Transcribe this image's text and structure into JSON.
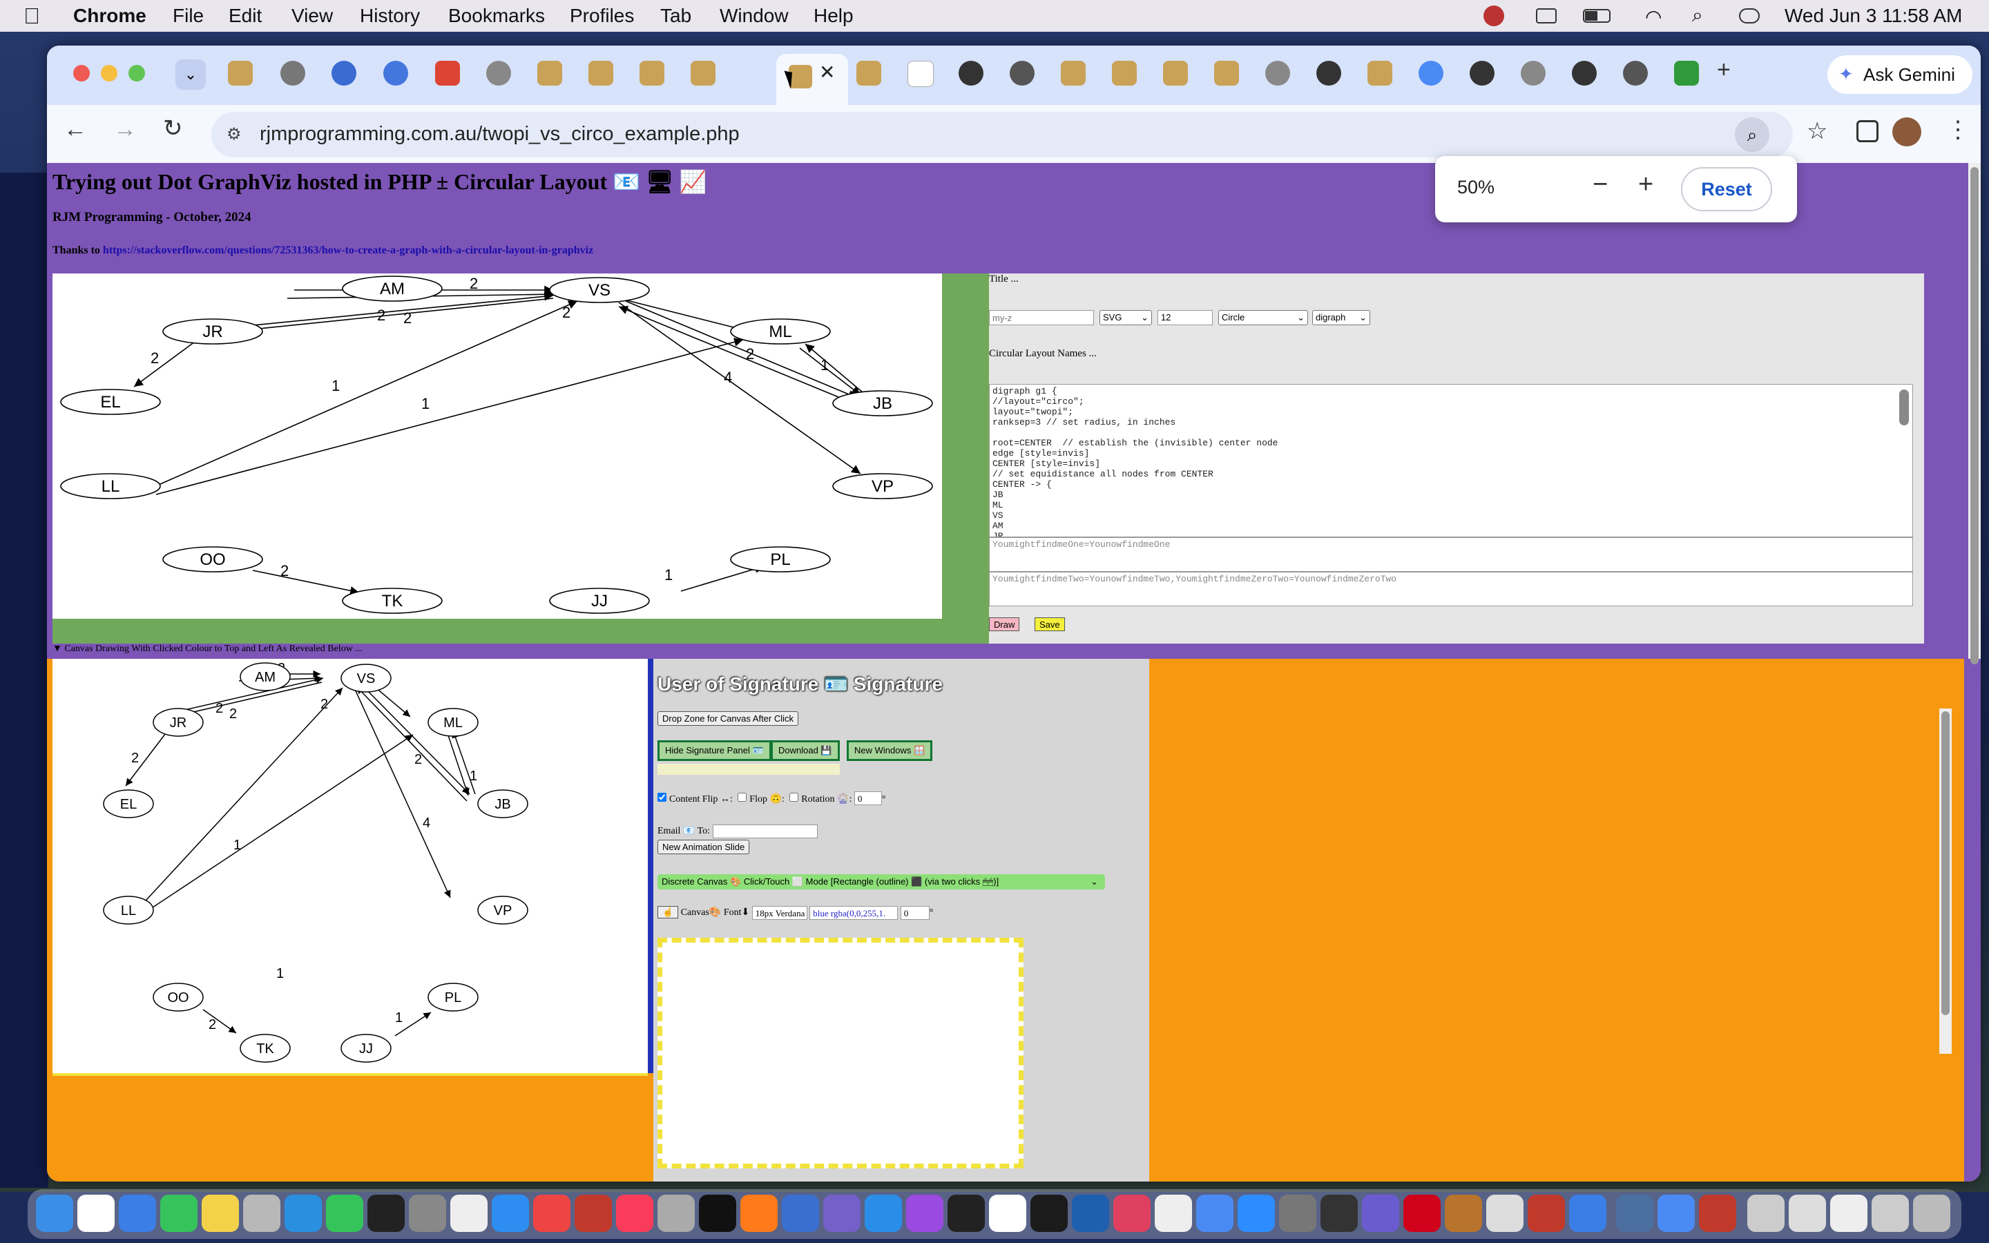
{
  "menubar": {
    "apple_icon": "apple-icon",
    "app": "Chrome",
    "items": [
      "File",
      "Edit",
      "View",
      "History",
      "Bookmarks",
      "Profiles",
      "Tab",
      "Window",
      "Help"
    ],
    "datetime": "Wed Jun 3  11:58 AM"
  },
  "browser": {
    "url": "rjmprogramming.com.au/twopi_vs_circo_example.php",
    "ask_gemini": "Ask Gemini",
    "new_tab": "+",
    "active_tab_close": "✕"
  },
  "zoom_popup": {
    "level": "50%",
    "minus": "−",
    "plus": "+",
    "reset": "Reset"
  },
  "page": {
    "title": "Trying out Dot GraphViz hosted in PHP ± Circular Layout 📧 🖥 📈",
    "author": "RJM Programming - October, 2024",
    "thanks_prefix": "Thanks to ",
    "thanks_link": "https://stackoverflow.com/questions/72531363/how-to-create-a-graph-with-a-circular-layout-in-graphviz",
    "title_label": "Title ...",
    "title_placeholder": "my-z",
    "format_value": "SVG",
    "size_value": "12",
    "shape_value": "Circle",
    "graphtype_value": "digraph",
    "names_label": "Circular Layout Names ...",
    "dot_source": "digraph g1 {\n//layout=\"circo\";\nlayout=\"twopi\";\nranksep=3 // set radius, in inches\n\nroot=CENTER  // establish the (invisible) center node\nedge [style=invis]\nCENTER [style=invis]\n// set equidistance all nodes from CENTER\nCENTER -> {\nJB\nML\nVS\nAM\nJR",
    "find_one": "YoumightfindmeOne=YounowfindmeOne",
    "find_two": "YoumightfindmeTwo=YounowfindmeTwo,YoumightfindmeZeroTwo=YounowfindmeZeroTwo",
    "draw_button": "Draw",
    "save_button": "Save",
    "canvas_summary": "▼ Canvas Drawing With Clicked Colour to Top and Left As Revealed Below ..."
  },
  "graph": {
    "nodes": [
      "AM",
      "VS",
      "JR",
      "ML",
      "EL",
      "JB",
      "LL",
      "VP",
      "OO",
      "PL",
      "TK",
      "JJ"
    ],
    "edge_labels": [
      "2",
      "2",
      "2",
      "2",
      "2",
      "2",
      "1",
      "1",
      "1",
      "4",
      "2",
      "1"
    ]
  },
  "signature": {
    "heading": "User of Signature 🪪 Signature",
    "drop_zone": "Drop Zone for Canvas After Click",
    "hide_panel": "Hide Signature Panel 🪪",
    "download": "Download 💾",
    "new_windows": "New Windows 🪟",
    "content_flip": "Content Flip ↔:",
    "flop": "Flop 🙃:",
    "rotation": "Rotation 🎡:",
    "rotation_value": "0",
    "degree": "°",
    "email_label": "Email 📧 To:",
    "new_animation": "New Animation Slide",
    "discrete_canvas": "Discrete Canvas 🎨 Click/Touch ⬜ Mode [Rectangle (outline) ⬛ (via two clicks 🖱🖱)]",
    "canvas_label": "Canvas🎨 Font⬇",
    "font_value": "18px Verdana",
    "color_value": "blue rgba(0,0,255,1.",
    "angle_value": "0"
  }
}
